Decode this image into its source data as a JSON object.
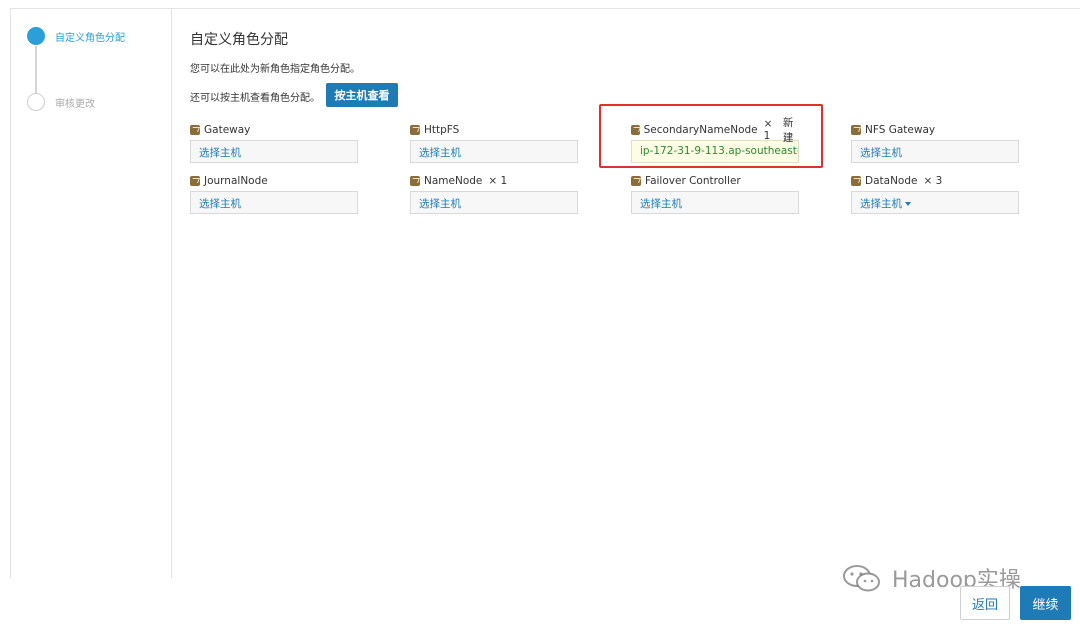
{
  "sidebar": {
    "steps": [
      {
        "label": "自定义角色分配",
        "active": true
      },
      {
        "label": "审核更改",
        "active": false
      }
    ]
  },
  "main": {
    "title": "自定义角色分配",
    "description": "您可以在此处为新角色指定角色分配。",
    "view_hint": "还可以按主机查看角色分配。",
    "view_button": "按主机查看",
    "roles": [
      {
        "name": "Gateway",
        "count": "",
        "tag": "",
        "selection": "选择主机"
      },
      {
        "name": "HttpFS",
        "count": "",
        "tag": "",
        "selection": "选择主机"
      },
      {
        "name": "SecondaryNameNode",
        "count": "× 1",
        "tag": "新建",
        "selection": "ip-172-31-9-113.ap-southeast-..."
      },
      {
        "name": "NFS Gateway",
        "count": "",
        "tag": "",
        "selection": "选择主机"
      },
      {
        "name": "JournalNode",
        "count": "",
        "tag": "",
        "selection": "选择主机"
      },
      {
        "name": "NameNode",
        "count": "× 1",
        "tag": "",
        "selection": "选择主机"
      },
      {
        "name": "Failover Controller",
        "count": "",
        "tag": "",
        "selection": "选择主机"
      },
      {
        "name": "DataNode",
        "count": "× 3",
        "tag": "",
        "selection": "选择主机"
      }
    ]
  },
  "footer": {
    "back_label": "返回",
    "continue_label": "继续"
  },
  "watermark": {
    "text": "Hadoop实操",
    "icon": "wechat-icon"
  },
  "colors": {
    "accent": "#1e7bb6",
    "step_active": "#2b9fd8",
    "highlight": "#e0302e"
  }
}
